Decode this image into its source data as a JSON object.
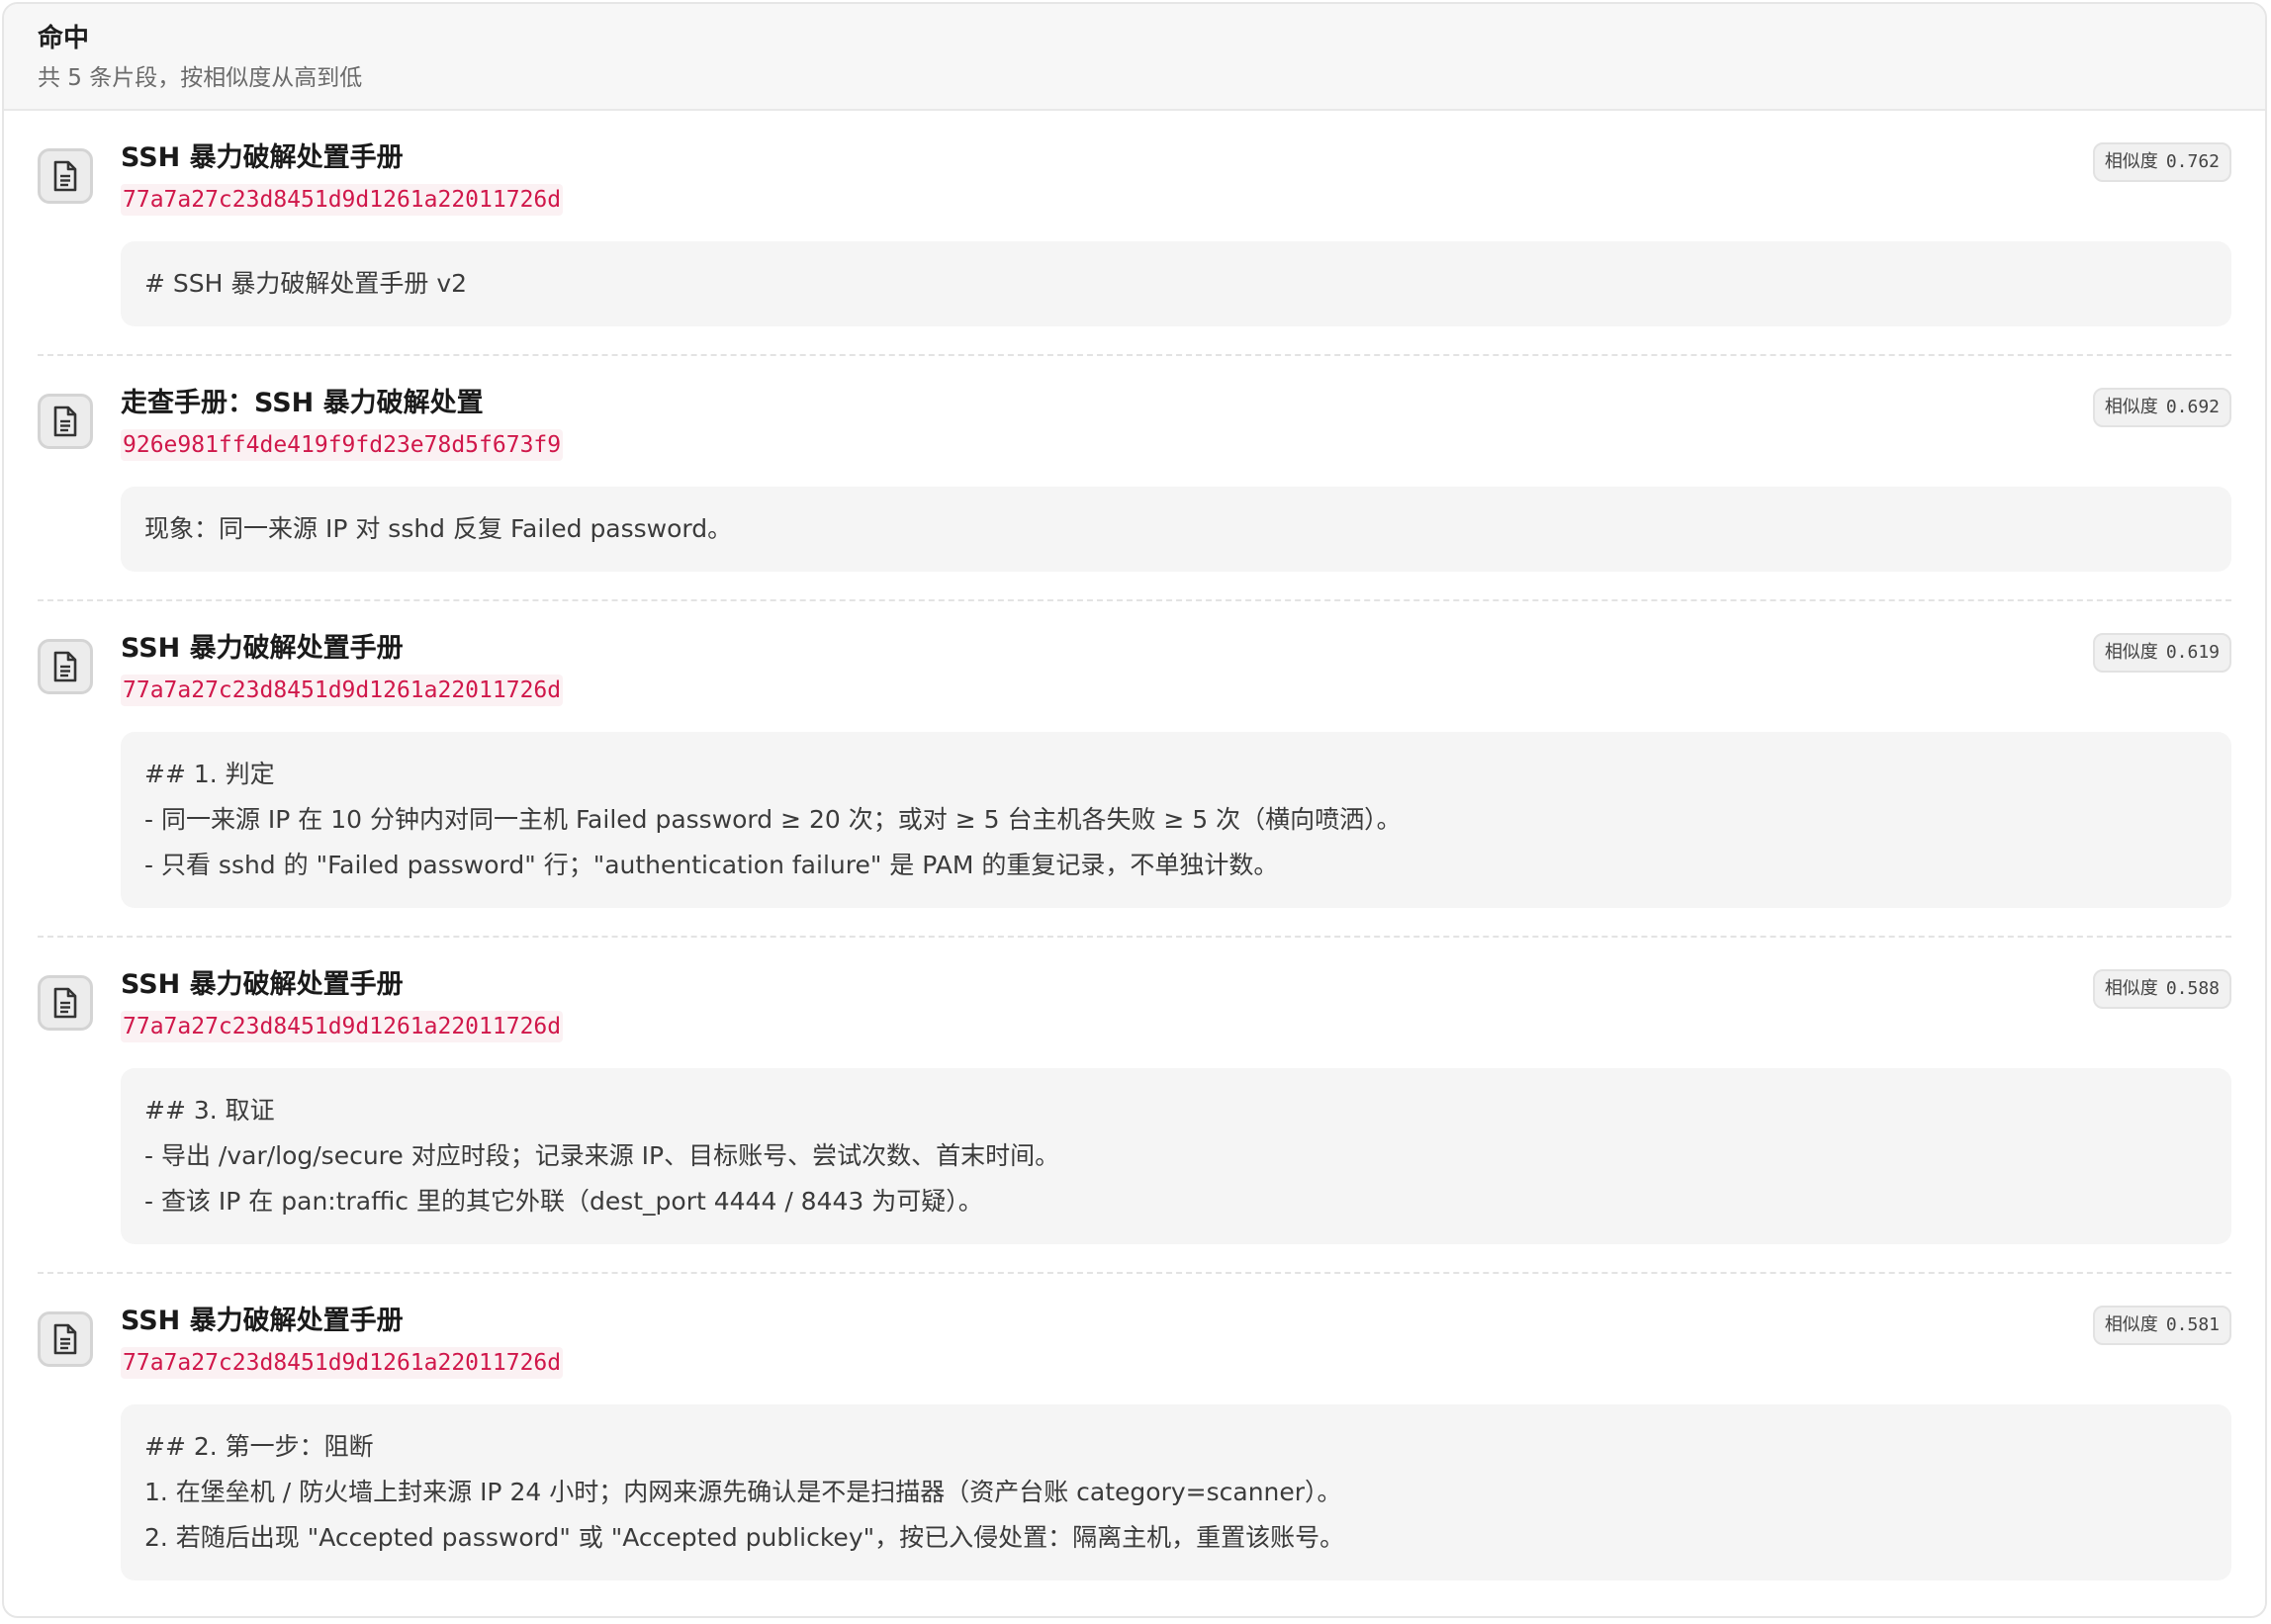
{
  "header": {
    "title": "命中",
    "subtitle": "共 5 条片段，按相似度从高到低"
  },
  "similarity_label": "相似度",
  "icons": {
    "result_icon": "document-icon"
  },
  "results": [
    {
      "title": "SSH 暴力破解处置手册",
      "id": "77a7a27c23d8451d9d1261a22011726d",
      "similarity": "0.762",
      "snippet": "# SSH 暴力破解处置手册 v2"
    },
    {
      "title": "走查手册：SSH 暴力破解处置",
      "id": "926e981ff4de419f9fd23e78d5f673f9",
      "similarity": "0.692",
      "snippet": "现象：同一来源 IP 对 sshd 反复 Failed password。"
    },
    {
      "title": "SSH 暴力破解处置手册",
      "id": "77a7a27c23d8451d9d1261a22011726d",
      "similarity": "0.619",
      "snippet": "## 1. 判定\n- 同一来源 IP 在 10 分钟内对同一主机 Failed password ≥ 20 次；或对 ≥ 5 台主机各失败 ≥ 5 次（横向喷洒）。\n- 只看 sshd 的 \"Failed password\" 行；\"authentication failure\" 是 PAM 的重复记录，不单独计数。"
    },
    {
      "title": "SSH 暴力破解处置手册",
      "id": "77a7a27c23d8451d9d1261a22011726d",
      "similarity": "0.588",
      "snippet": "## 3. 取证\n- 导出 /var/log/secure 对应时段；记录来源 IP、目标账号、尝试次数、首末时间。\n- 查该 IP 在 pan:traffic 里的其它外联（dest_port 4444 / 8443 为可疑）。"
    },
    {
      "title": "SSH 暴力破解处置手册",
      "id": "77a7a27c23d8451d9d1261a22011726d",
      "similarity": "0.581",
      "snippet": "## 2. 第一步：阻断\n1. 在堡垒机 / 防火墙上封来源 IP 24 小时；内网来源先确认是不是扫描器（资产台账 category=scanner）。\n2. 若随后出现 \"Accepted password\" 或 \"Accepted publickey\"，按已入侵处置：隔离主机，重置该账号。"
    }
  ]
}
